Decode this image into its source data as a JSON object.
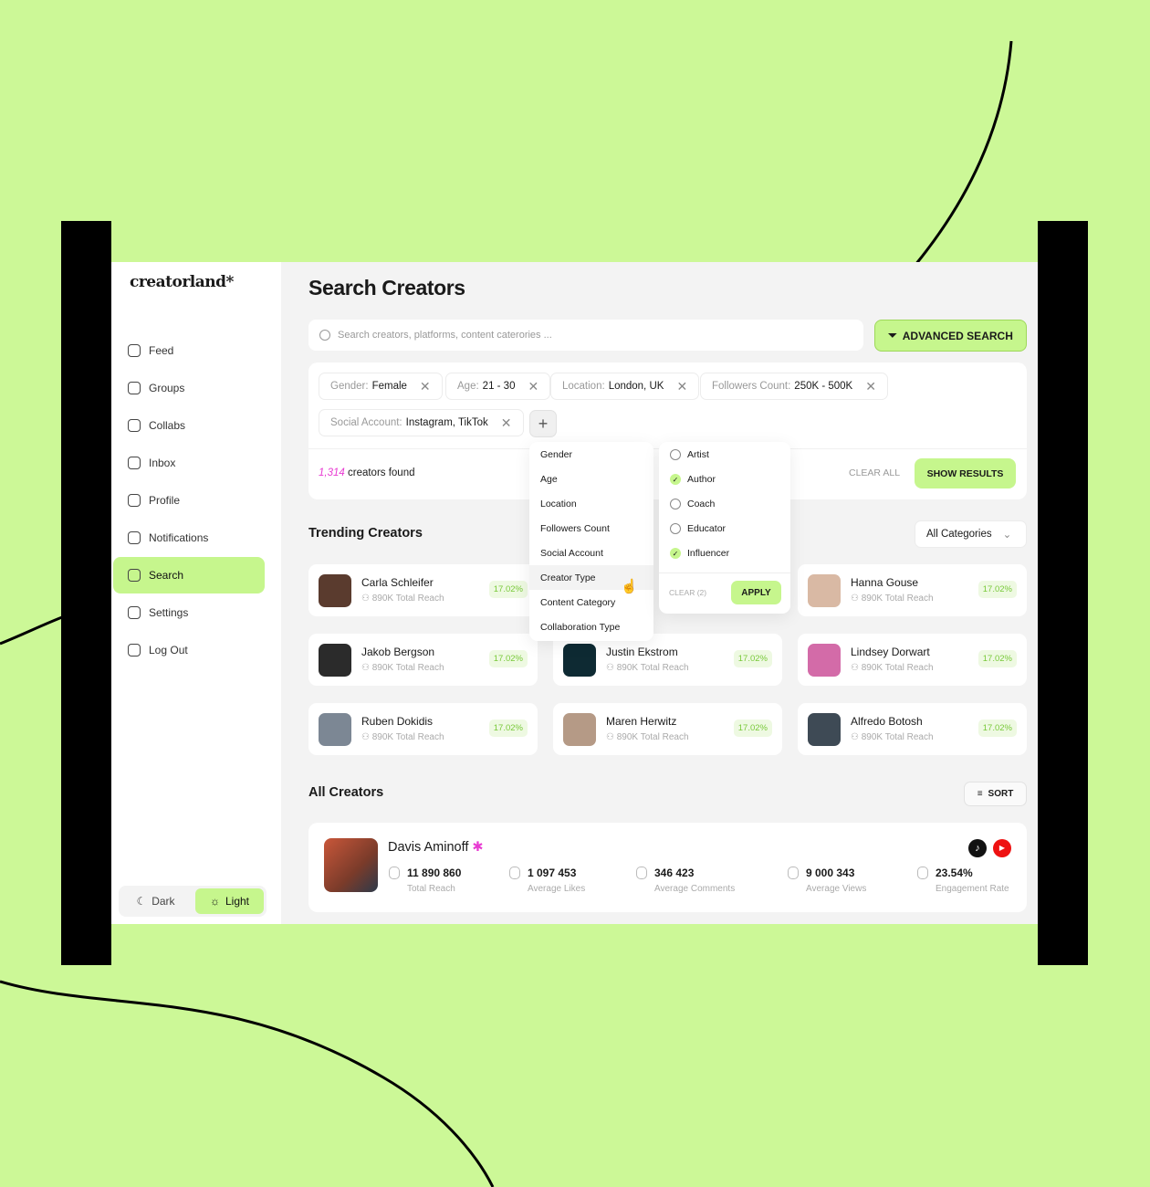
{
  "app": {
    "logo": "creatorland*"
  },
  "sidebar": {
    "items": [
      {
        "label": "Feed",
        "icon": "home-icon"
      },
      {
        "label": "Groups",
        "icon": "groups-icon"
      },
      {
        "label": "Collabs",
        "icon": "users-icon"
      },
      {
        "label": "Inbox",
        "icon": "chat-icon"
      },
      {
        "label": "Profile",
        "icon": "user-icon"
      },
      {
        "label": "Notifications",
        "icon": "bell-icon"
      },
      {
        "label": "Search",
        "icon": "search-icon",
        "active": true
      },
      {
        "label": "Settings",
        "icon": "gear-icon"
      },
      {
        "label": "Log Out",
        "icon": "logout-icon"
      }
    ],
    "theme": {
      "dark": "Dark",
      "light": "Light",
      "selected": "Light"
    }
  },
  "main": {
    "title": "Search Creators",
    "search_placeholder": "Search creators, platforms, content caterories ...",
    "advanced_label": "ADVANCED SEARCH",
    "filters": [
      {
        "key": "Gender:",
        "value": "Female"
      },
      {
        "key": "Age:",
        "value": "21 - 30"
      },
      {
        "key": "Location:",
        "value": "London, UK"
      },
      {
        "key": "Followers Count:",
        "value": "250K - 500K"
      },
      {
        "key": "Social Account:",
        "value": "Instagram, TikTok"
      }
    ],
    "count": "1,314",
    "count_suffix": "creators found",
    "clear_all": "CLEAR ALL",
    "show_results": "SHOW RESULTS",
    "menu": [
      "Gender",
      "Age",
      "Location",
      "Followers Count",
      "Social Account",
      "Creator Type",
      "Content Category",
      "Collaboration Type"
    ],
    "menu_hover": "Creator Type",
    "creator_types": [
      {
        "label": "Artist",
        "checked": false
      },
      {
        "label": "Author",
        "checked": true
      },
      {
        "label": "Coach",
        "checked": false
      },
      {
        "label": "Educator",
        "checked": false
      },
      {
        "label": "Influencer",
        "checked": true
      }
    ],
    "clear_label": "CLEAR (2)",
    "apply_label": "APPLY",
    "trending_title": "Trending Creators",
    "category_select": "All Categories",
    "trending": [
      {
        "name": "Carla Schleifer",
        "reach": "890K Total Reach",
        "rate": "17.02%"
      },
      {
        "name": "",
        "reach": "",
        "rate": ""
      },
      {
        "name": "Hanna Gouse",
        "reach": "890K Total Reach",
        "rate": "17.02%"
      },
      {
        "name": "Jakob Bergson",
        "reach": "890K Total Reach",
        "rate": "17.02%"
      },
      {
        "name": "Justin Ekstrom",
        "reach": "890K Total Reach",
        "rate": "17.02%"
      },
      {
        "name": "Lindsey Dorwart",
        "reach": "890K Total Reach",
        "rate": "17.02%"
      },
      {
        "name": "Ruben Dokidis",
        "reach": "890K Total Reach",
        "rate": "17.02%"
      },
      {
        "name": "Maren Herwitz",
        "reach": "890K Total Reach",
        "rate": "17.02%"
      },
      {
        "name": "Alfredo Botosh",
        "reach": "890K Total Reach",
        "rate": "17.02%"
      }
    ],
    "all_title": "All Creators",
    "sort_label": "SORT",
    "featured": {
      "name": "Davis Aminoff",
      "badge": "✱",
      "stats": [
        {
          "value": "11 890 860",
          "label": "Total Reach"
        },
        {
          "value": "1 097 453",
          "label": "Average Likes"
        },
        {
          "value": "346 423",
          "label": "Average Comments"
        },
        {
          "value": "9 000 343",
          "label": "Average Views"
        },
        {
          "value": "23.54%",
          "label": "Engagement Rate"
        }
      ],
      "platforms": [
        "tiktok-icon",
        "youtube-icon"
      ]
    }
  },
  "colors": {
    "background": "#ccf897",
    "accent": "#c6f68d",
    "highlight": "#e83bd2"
  }
}
